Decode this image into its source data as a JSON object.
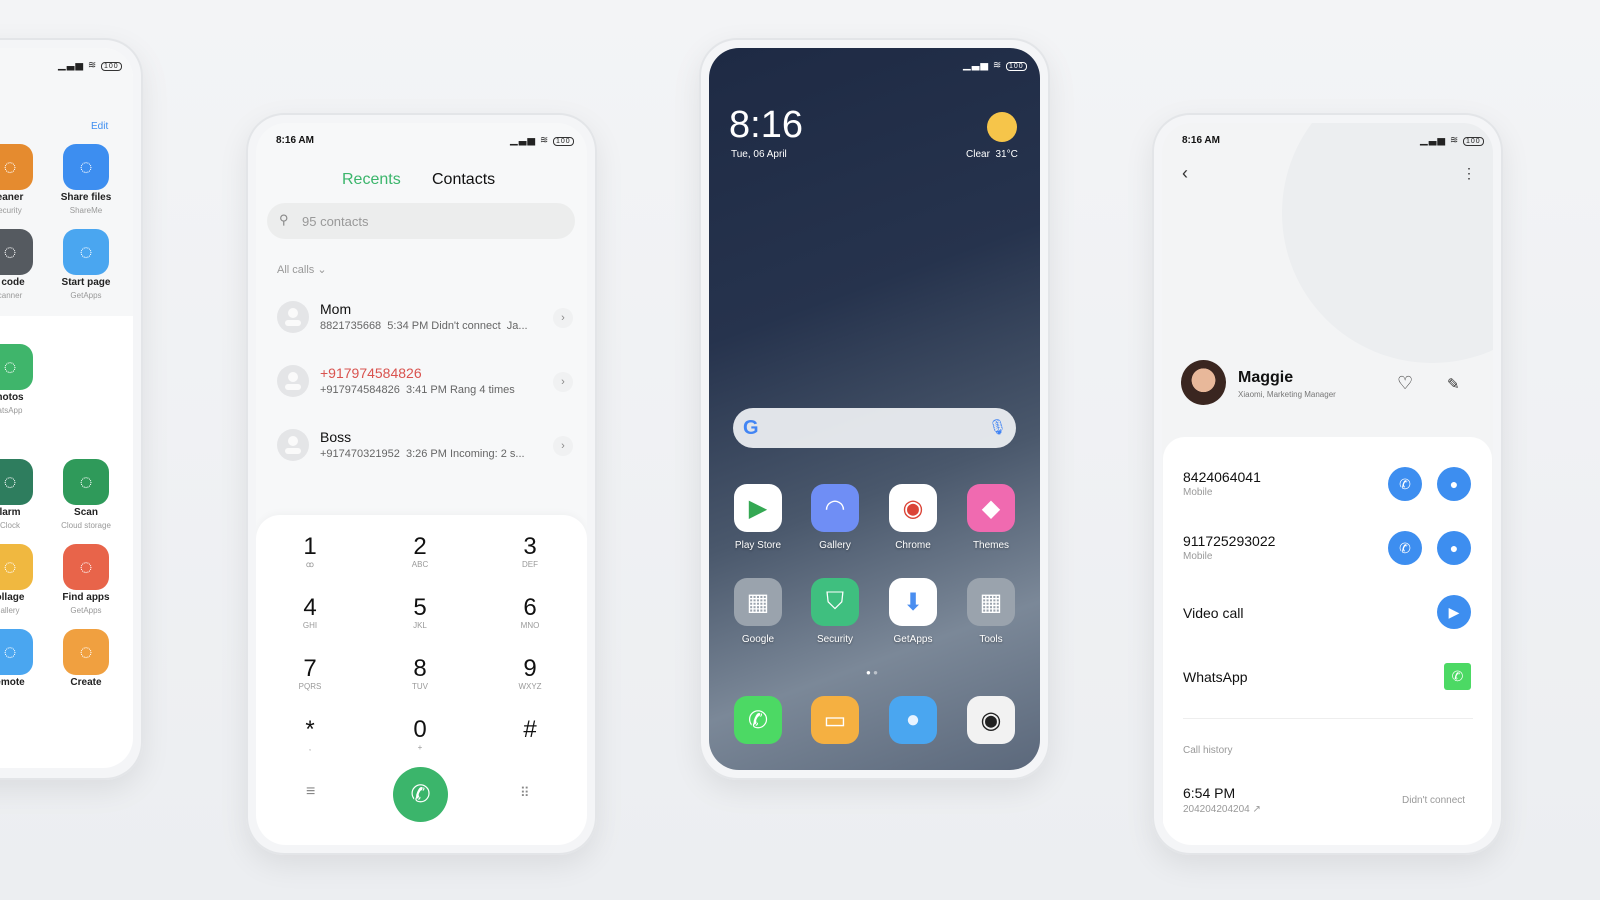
{
  "status": {
    "time": "8:16 AM",
    "battery": "100",
    "signal": "signal-icon",
    "wifi": "wifi-icon"
  },
  "colors": {
    "accent_green": "#3bb56b",
    "blue": "#3d8ef0",
    "missed_red": "#d9534f",
    "whatsapp": "#4cd964"
  },
  "left_phone": {
    "edit": "Edit",
    "apps": [
      {
        "label": "eaner",
        "sub": "ecurity",
        "color": "#e58b2f",
        "icon": "broom-icon"
      },
      {
        "label": "Share files",
        "sub": "ShareMe",
        "color": "#3d8ef0",
        "icon": "infinity-icon"
      },
      {
        "label": "t code",
        "sub": "canner",
        "color": "#555a60",
        "icon": "scanner-icon"
      },
      {
        "label": "Start page",
        "sub": "GetApps",
        "color": "#4aa6f0",
        "icon": "compass-icon"
      },
      {
        "label": "hotos",
        "sub": "atsApp",
        "color": "#3fb56b",
        "icon": "camera-icon"
      },
      {
        "label": "larm",
        "sub": "Clock",
        "color": "#2e7d5e",
        "icon": "clock-icon"
      },
      {
        "label": "Scan",
        "sub": "Cloud storage",
        "color": "#2f9a5a",
        "icon": "scan-icon"
      },
      {
        "label": "ollage",
        "sub": "allery",
        "color": "#f0b840",
        "icon": "collage-icon"
      },
      {
        "label": "Find apps",
        "sub": "GetApps",
        "color": "#e8644a",
        "icon": "find-apps-icon"
      },
      {
        "label": "emote",
        "sub": "",
        "color": "#4aa6f0",
        "icon": "remote-icon"
      },
      {
        "label": "Create",
        "sub": "",
        "color": "#f0a040",
        "icon": "note-icon"
      }
    ]
  },
  "dialer": {
    "tabs": [
      "Recents",
      "Contacts"
    ],
    "search_placeholder": "95 contacts",
    "filter": "All calls",
    "calls": [
      {
        "name": "Mom",
        "detail": "8821735668  5:34 PM Didn't connect  Ja...",
        "missed": false
      },
      {
        "name": "+917974584826",
        "detail": "+917974584826  3:41 PM Rang 4 times",
        "missed": true
      },
      {
        "name": "Boss",
        "detail": "+917470321952  3:26 PM Incoming: 2 s...",
        "missed": false
      }
    ],
    "keys": [
      {
        "d": "1",
        "l": "ꝏ"
      },
      {
        "d": "2",
        "l": "ABC"
      },
      {
        "d": "3",
        "l": "DEF"
      },
      {
        "d": "4",
        "l": "GHI"
      },
      {
        "d": "5",
        "l": "JKL"
      },
      {
        "d": "6",
        "l": "MNO"
      },
      {
        "d": "7",
        "l": "PQRS"
      },
      {
        "d": "8",
        "l": "TUV"
      },
      {
        "d": "9",
        "l": "WXYZ"
      },
      {
        "d": "*",
        "l": ","
      },
      {
        "d": "0",
        "l": "+"
      },
      {
        "d": "#",
        "l": ""
      }
    ]
  },
  "home": {
    "time": "8:16",
    "date": "Tue, 06 April",
    "weather": "Clear  31°C",
    "apps": [
      {
        "name": "Play Store",
        "bg": "#ffffff",
        "g": "▶",
        "c": "#34a853"
      },
      {
        "name": "Gallery",
        "bg": "#6f8ef5",
        "g": "◠",
        "c": "#fff"
      },
      {
        "name": "Chrome",
        "bg": "#ffffff",
        "g": "◉",
        "c": "#db4437"
      },
      {
        "name": "Themes",
        "bg": "#f06ab0",
        "g": "◆",
        "c": "#fff"
      },
      {
        "name": "Google",
        "bg": "#9aa3ad",
        "g": "▦",
        "c": "#fff"
      },
      {
        "name": "Security",
        "bg": "#3fbf7f",
        "g": "⛉",
        "c": "#fff"
      },
      {
        "name": "GetApps",
        "bg": "#ffffff",
        "g": "⬇",
        "c": "#4a8ef0"
      },
      {
        "name": "Tools",
        "bg": "#9aa3ad",
        "g": "▦",
        "c": "#fff"
      }
    ],
    "dock": [
      {
        "name": "phone",
        "bg": "#4cd964",
        "g": "✆",
        "c": "#fff"
      },
      {
        "name": "notes",
        "bg": "#f5b041",
        "g": "▭",
        "c": "#fff"
      },
      {
        "name": "messages",
        "bg": "#4aa6f0",
        "g": "●",
        "c": "#e8f3ff"
      },
      {
        "name": "camera",
        "bg": "#f2f2f2",
        "g": "◉",
        "c": "#222"
      }
    ]
  },
  "contact": {
    "name": "Maggie",
    "subtitle": "Xiaomi, Marketing Manager",
    "numbers": [
      {
        "number": "8424064041",
        "type": "Mobile"
      },
      {
        "number": "911725293022",
        "type": "Mobile"
      }
    ],
    "video_call": "Video call",
    "whatsapp": "WhatsApp",
    "call_history_label": "Call history",
    "history": {
      "time": "6:54 PM",
      "number": "204204204204",
      "status": "Didn't connect"
    }
  }
}
